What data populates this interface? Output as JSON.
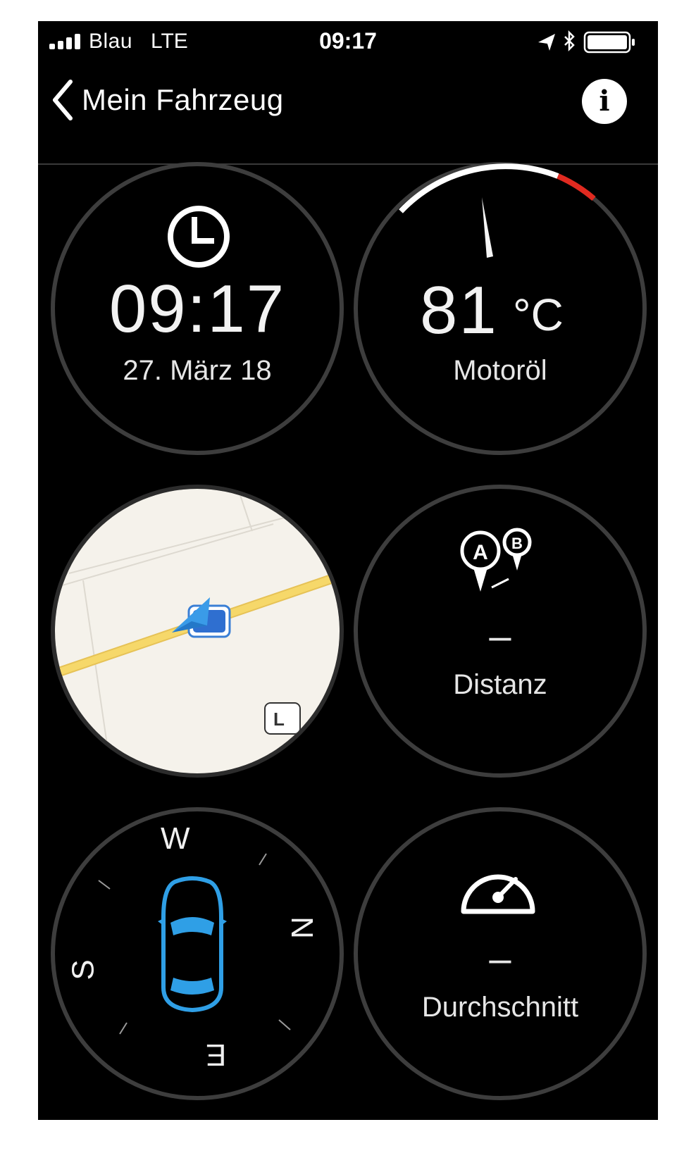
{
  "status_bar": {
    "carrier": "Blau",
    "network": "LTE",
    "time": "09:17",
    "icons": [
      "signal-icon",
      "location-arrow-icon",
      "bluetooth-icon",
      "battery-icon"
    ]
  },
  "nav": {
    "back_label": "Mein Fahrzeug",
    "info_label": "i"
  },
  "tiles": {
    "clock": {
      "time": "09:17",
      "date": "27. März 18",
      "icon": "clock-icon"
    },
    "oil": {
      "value": "81",
      "unit": "°C",
      "label": "Motoröl",
      "icon": "gauge-needle-icon",
      "gauge_red_color": "#e02a20"
    },
    "map": {
      "icon": "location-arrow-icon",
      "road_color": "#f6d86a",
      "land_color": "#f5f2eb",
      "marker_color": "#3a9be8"
    },
    "distance": {
      "value": "–",
      "label": "Distanz",
      "icon": "route-a-b-icon",
      "marker_a": "A",
      "marker_b": "B"
    },
    "compass": {
      "w": "W",
      "n": "N",
      "e": "E",
      "s": "S",
      "icon": "car-top-view-icon",
      "car_color": "#2f9fe6"
    },
    "average": {
      "value": "–",
      "label": "Durchschnitt",
      "icon": "speedometer-icon"
    }
  }
}
